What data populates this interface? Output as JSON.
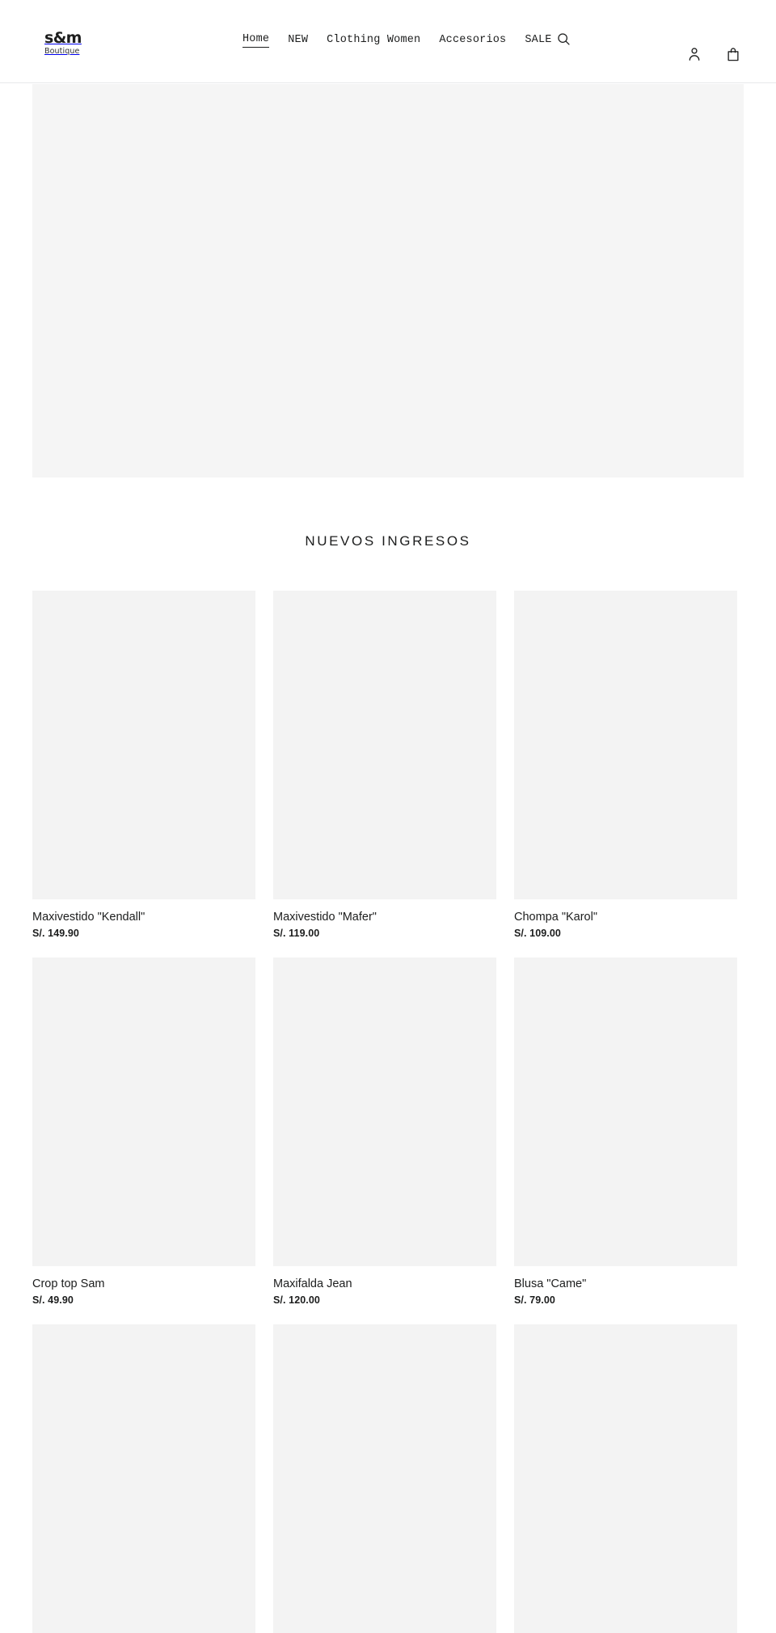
{
  "header": {
    "logo": {
      "mark": "s&m",
      "subtitle": "Boutique",
      "icon": "brand-logo"
    },
    "nav": [
      {
        "label": "Home",
        "active": true
      },
      {
        "label": "NEW",
        "active": false
      },
      {
        "label": "Clothing Women",
        "active": false
      },
      {
        "label": "Accesorios",
        "active": false
      },
      {
        "label": "SALE",
        "active": false
      }
    ],
    "search": {
      "icon": "search-icon",
      "label": "Search"
    },
    "actions": [
      {
        "icon": "account-icon",
        "label": "Log in"
      },
      {
        "icon": "cart-icon",
        "label": "Cart"
      }
    ]
  },
  "hero": {
    "icon": "hero-banner-placeholder"
  },
  "collection": {
    "title": "NUEVOS INGRESOS",
    "products": [
      {
        "title": "Maxivestido \"Kendall\"",
        "price": "S/. 149.90",
        "loaded": true
      },
      {
        "title": "Maxivestido \"Mafer\"",
        "price": "S/. 119.00",
        "loaded": true
      },
      {
        "title": "Chompa \"Karol\"",
        "price": "S/. 109.00",
        "loaded": true
      },
      {
        "title": "Crop top Sam",
        "price": "S/. 49.90",
        "loaded": true
      },
      {
        "title": "Maxifalda Jean",
        "price": "S/. 120.00",
        "loaded": true
      },
      {
        "title": "Blusa \"Came\"",
        "price": "S/. 79.00",
        "loaded": true
      },
      {
        "title": "",
        "price": "",
        "loaded": false
      },
      {
        "title": "",
        "price": "",
        "loaded": false
      },
      {
        "title": "",
        "price": "",
        "loaded": false
      }
    ]
  }
}
